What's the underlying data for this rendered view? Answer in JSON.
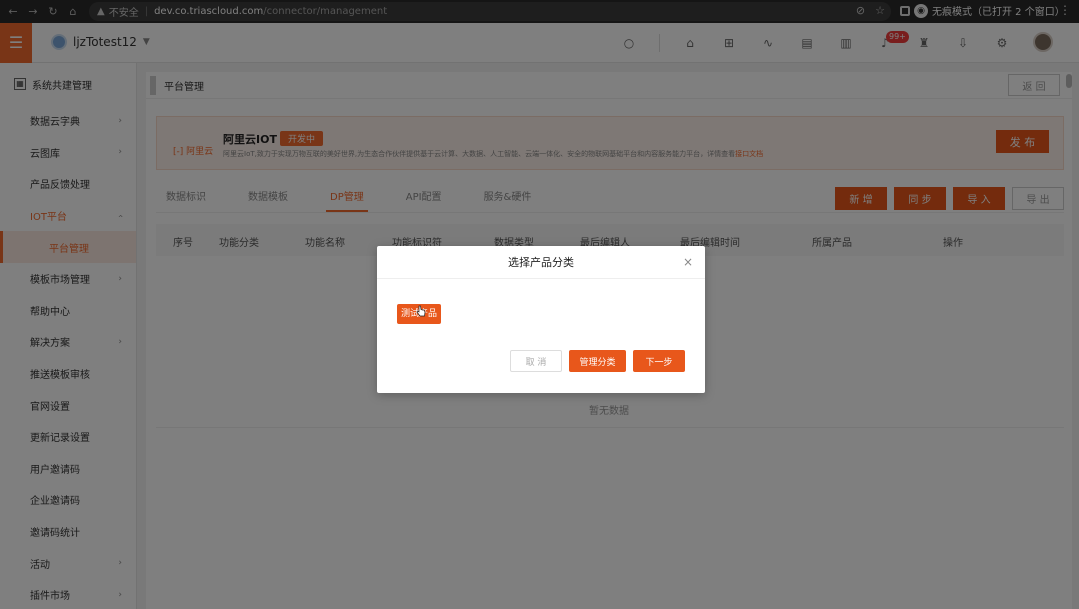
{
  "browser": {
    "insecure_label": "不安全",
    "url_host": "dev.co.triascloud.com",
    "url_path": "/connector/management",
    "incognito_label": "无痕模式（已打开 2 个窗口）"
  },
  "header": {
    "tenant_name": "ljzTotest12",
    "notification_badge": "99+"
  },
  "sidebar": {
    "section_title": "系统共建管理",
    "items": [
      {
        "label": "数据云字典",
        "arrow": "›"
      },
      {
        "label": "云图库",
        "arrow": "›"
      },
      {
        "label": "产品反馈处理",
        "arrow": ""
      },
      {
        "label": "IOT平台",
        "arrow": "‹"
      },
      {
        "label": "平台管理",
        "arrow": ""
      },
      {
        "label": "模板市场管理",
        "arrow": "›"
      },
      {
        "label": "帮助中心",
        "arrow": ""
      },
      {
        "label": "解决方案",
        "arrow": "›"
      },
      {
        "label": "推送模板审核",
        "arrow": ""
      },
      {
        "label": "官网设置",
        "arrow": ""
      },
      {
        "label": "更新记录设置",
        "arrow": ""
      },
      {
        "label": "用户邀请码",
        "arrow": ""
      },
      {
        "label": "企业邀请码",
        "arrow": ""
      },
      {
        "label": "邀请码统计",
        "arrow": ""
      },
      {
        "label": "活动",
        "arrow": "›"
      },
      {
        "label": "插件市场",
        "arrow": "›"
      }
    ]
  },
  "main": {
    "breadcrumb": "平台管理",
    "back_label": "返 回",
    "platform": {
      "logo_text": "[-] 阿里云",
      "name": "阿里云IOT",
      "status": "开发中",
      "desc": "阿里云IoT,致力于实现万物互联的美好世界,为生态合作伙伴提供基于云计算、大数据、人工智能、云端一体化、安全的物联网基础平台和内容服务能力平台，详情查看",
      "doc_link": "接口文档",
      "publish_label": "发 布"
    },
    "tabs": [
      "数据标识",
      "数据模板",
      "DP管理",
      "API配置",
      "服务&硬件"
    ],
    "actions": {
      "add": "新 增",
      "sync": "同 步",
      "import": "导 入",
      "export": "导 出"
    },
    "columns": [
      "序号",
      "功能分类",
      "功能名称",
      "功能标识符",
      "数据类型",
      "最后编辑人",
      "最后编辑时间",
      "所属产品",
      "操作"
    ],
    "empty_text": "暂无数据"
  },
  "modal": {
    "title": "选择产品分类",
    "chip": "测试产品",
    "cancel": "取 消",
    "manage": "管理分类",
    "next": "下一步"
  }
}
